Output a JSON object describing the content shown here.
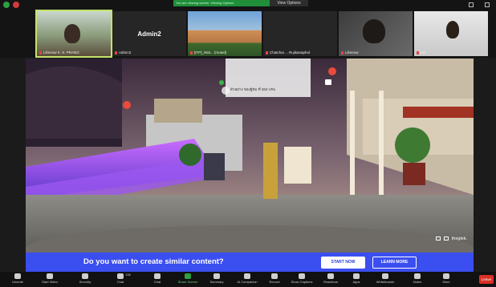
{
  "top": {
    "share_banner": "You are viewing screen. Viewing Options",
    "view_options": "View Options"
  },
  "participants": [
    {
      "name": "Lilmeow K. S. PRANG"
    },
    {
      "name": "Admin2",
      "display": "Admin2"
    },
    {
      "name": "[ITP]_Wat... (muted)"
    },
    {
      "name": "Chatchai ... Rujikanaphol"
    },
    {
      "name": "Lilmeow"
    },
    {
      "name": "KB"
    }
  ],
  "stage": {
    "info_text": "ตัวอย่าง ของผู้ชม ที่ 360 VRs",
    "brand": "theglek."
  },
  "cta": {
    "headline": "Do you want to create similar content?",
    "start_now": "START NOW",
    "learn_more": "LEARN MORE"
  },
  "toolbar": {
    "items": [
      "Unmute",
      "Start Video",
      "Security",
      "Participants",
      "Chat",
      "Share Screen",
      "Summary",
      "AI Companion",
      "Record",
      "Show Captions",
      "Reactions",
      "Apps",
      "Whiteboards",
      "Notes",
      "More"
    ],
    "participants_count": "136",
    "leave": "Leave"
  },
  "colors": {
    "accent_green": "#2ea043",
    "cta_blue": "#3b4ef0",
    "leave_red": "#d93025"
  }
}
